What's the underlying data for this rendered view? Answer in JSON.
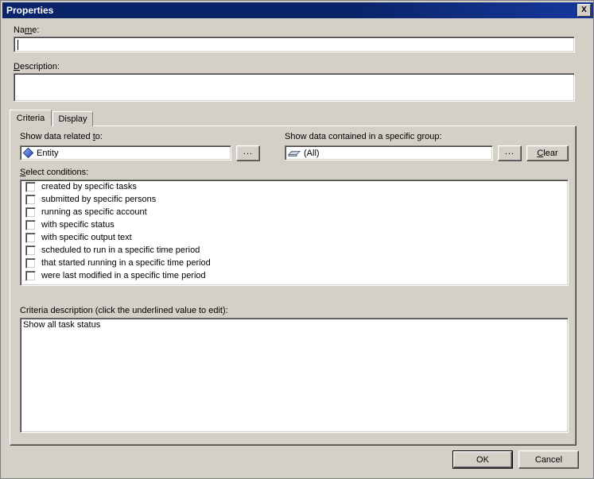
{
  "window": {
    "title": "Properties",
    "close_icon": "close-icon",
    "close_label": "X"
  },
  "form": {
    "name": {
      "label_before": "Na",
      "label_accel": "m",
      "label_after": "e:",
      "value": "",
      "placeholder": ""
    },
    "description": {
      "label_accel": "D",
      "label_after": "escription:",
      "value": "",
      "placeholder": ""
    }
  },
  "tabs": [
    {
      "label": "Criteria",
      "selected": true
    },
    {
      "label": "Display",
      "selected": false
    }
  ],
  "criteria_tab": {
    "related": {
      "label_before": "Show data related ",
      "label_accel": "t",
      "label_after": "o:",
      "value": "Entity",
      "icon": "entity-diamond-icon",
      "browse_label": "..."
    },
    "group": {
      "label_before": "Show data contained in a specific ",
      "label_accel": "g",
      "label_after": "roup:",
      "value": "(All)",
      "icon": "group-icon",
      "browse_label": "...",
      "clear_accel": "C",
      "clear_after": "lear"
    },
    "conditions": {
      "label_accel": "S",
      "label_after": "elect conditions:",
      "items": [
        {
          "label": "created by specific tasks",
          "checked": false
        },
        {
          "label": "submitted by specific persons",
          "checked": false
        },
        {
          "label": "running as specific account",
          "checked": false
        },
        {
          "label": "with specific status",
          "checked": false
        },
        {
          "label": "with specific output text",
          "checked": false
        },
        {
          "label": "scheduled to run in a specific time period",
          "checked": false
        },
        {
          "label": "that started running in a specific time period",
          "checked": false
        },
        {
          "label": "were last modified in a specific time period",
          "checked": false
        }
      ]
    },
    "criteria_description": {
      "label": "Criteria description (click the underlined value to edit):",
      "text": "Show all task status"
    }
  },
  "footer": {
    "ok_label": "OK",
    "cancel_label": "Cancel"
  },
  "colors": {
    "titlebar_start": "#0a246a",
    "titlebar_end": "#16389c",
    "dialog_face": "#d4d0c8",
    "field_bg": "#ffffff",
    "entity_icon": "#4a6fd4"
  }
}
